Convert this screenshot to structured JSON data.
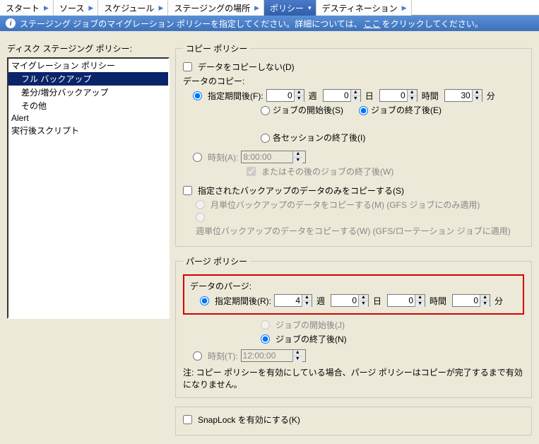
{
  "tabs": {
    "t0": "スタート",
    "t1": "ソース",
    "t2": "スケジュール",
    "t3": "ステージングの場所",
    "t4": "ポリシー",
    "t5": "デスティネーション"
  },
  "banner": {
    "pre": "ステージング ジョブのマイグレーション ポリシーを指定してください。詳細については、",
    "link": "ここ",
    "post": " をクリックしてください。"
  },
  "left_label": "ディスク ステージング ポリシー:",
  "list": {
    "i0": "マイグレーション ポリシー",
    "i1": "フル バックアップ",
    "i2": "差分/増分バックアップ",
    "i3": "その他",
    "i4": "Alert",
    "i5": "実行後スクリプト"
  },
  "copy_policy": {
    "legend": "コピー ポリシー",
    "no_copy": "データをコピーしない(D)",
    "copy_label": "データのコピー:",
    "after_period": "指定期間後(F):",
    "week": "週",
    "day": "日",
    "hour": "時間",
    "min": "分",
    "val_w": "0",
    "val_d": "0",
    "val_h": "0",
    "val_m": "30",
    "r_start": "ジョブの開始後(S)",
    "r_end": "ジョブの終了後(E)",
    "r_sess": "各セッションの終了後(I)",
    "at_time": "時刻(A):",
    "time_val": "8:00:00",
    "or_after": "またはその後のジョブの終了後(W)",
    "only_backed": "指定されたバックアップのデータのみをコピーする(S)",
    "monthly": "月単位バックアップのデータをコピーする(M) (GFS ジョブにのみ適用)",
    "weekly": "週単位バックアップのデータをコピーする(W) (GFS/ローテーション ジョブに適用)"
  },
  "purge_policy": {
    "legend": "パージ ポリシー",
    "purge_label": "データのパージ:",
    "after_period": "指定期間後(R):",
    "week": "週",
    "day": "日",
    "hour": "時間",
    "min": "分",
    "val_w": "4",
    "val_d": "0",
    "val_h": "0",
    "val_m": "0",
    "r_start": "ジョブの開始後(J)",
    "r_end": "ジョブの終了後(N)",
    "at_time": "時刻(T):",
    "time_val": "12:00:00",
    "note": "注: コピー ポリシーを有効にしている場合、パージ ポリシーはコピーが完了するまで有効になりません。"
  },
  "snaplock": "SnapLock を有効にする(K)"
}
